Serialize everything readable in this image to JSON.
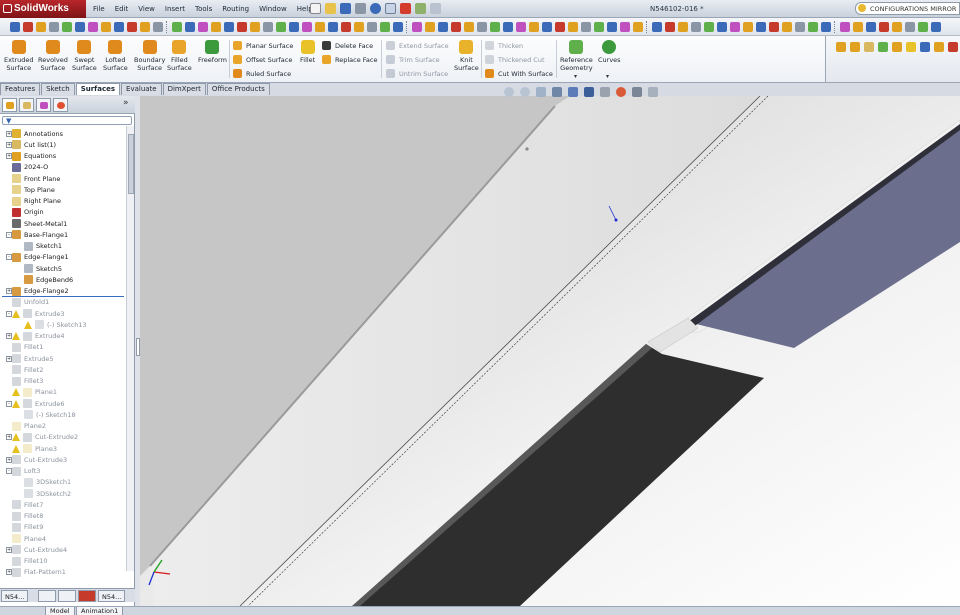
{
  "app": {
    "name": "SolidWorks",
    "document_title": "N546102-016 *",
    "config_search": "CONFIGURATIONS MIRROR"
  },
  "menu": [
    "File",
    "Edit",
    "View",
    "Insert",
    "Tools",
    "Routing",
    "Window",
    "Help"
  ],
  "command_manager": {
    "big": [
      {
        "label": "Extruded\nSurface",
        "icon": "extruded-surface-icon",
        "color": "#e08a1e"
      },
      {
        "label": "Revolved\nSurface",
        "icon": "revolved-surface-icon",
        "color": "#e08a1e"
      },
      {
        "label": "Swept\nSurface",
        "icon": "swept-surface-icon",
        "color": "#e08a1e"
      },
      {
        "label": "Lofted\nSurface",
        "icon": "lofted-surface-icon",
        "color": "#e08a1e"
      },
      {
        "label": "Boundary\nSurface",
        "icon": "boundary-surface-icon",
        "color": "#e08a1e"
      },
      {
        "label": "Filled\nSurface",
        "icon": "filled-surface-icon",
        "color": "#e8a52a"
      },
      {
        "label": "Freeform",
        "icon": "freeform-icon",
        "color": "#3c9a3c"
      }
    ],
    "small_col1": [
      {
        "label": "Planar Surface",
        "icon": "planar-surface-icon",
        "enabled": true
      },
      {
        "label": "Offset Surface",
        "icon": "offset-surface-icon",
        "enabled": true
      },
      {
        "label": "Ruled Surface",
        "icon": "ruled-surface-icon",
        "enabled": true
      }
    ],
    "fillet": {
      "label": "Fillet",
      "icon": "fillet-icon"
    },
    "small_col2": [
      {
        "label": "Delete Face",
        "icon": "delete-face-icon",
        "enabled": true
      },
      {
        "label": "Replace Face",
        "icon": "replace-face-icon",
        "enabled": true
      }
    ],
    "small_col3": [
      {
        "label": "Extend Surface",
        "icon": "extend-surface-icon",
        "enabled": false
      },
      {
        "label": "Trim Surface",
        "icon": "trim-surface-icon",
        "enabled": false
      },
      {
        "label": "Untrim Surface",
        "icon": "untrim-surface-icon",
        "enabled": false
      }
    ],
    "knit": {
      "label": "Knit\nSurface",
      "icon": "knit-surface-icon"
    },
    "small_col4": [
      {
        "label": "Thicken",
        "icon": "thicken-icon",
        "enabled": false
      },
      {
        "label": "Thickened Cut",
        "icon": "thickened-cut-icon",
        "enabled": false
      },
      {
        "label": "Cut With Surface",
        "icon": "cut-with-surface-icon",
        "enabled": true
      }
    ],
    "ref_geometry": {
      "label": "Reference\nGeometry",
      "icon": "reference-geometry-icon"
    },
    "curves": {
      "label": "Curves",
      "icon": "curves-icon"
    }
  },
  "tabs": [
    "Features",
    "Sketch",
    "Surfaces",
    "Evaluate",
    "DimXpert",
    "Office Products"
  ],
  "active_tab": "Surfaces",
  "tree": [
    {
      "label": "Annotations",
      "icon": "annotations-icon",
      "level": 0,
      "state": "normal",
      "expander": "+"
    },
    {
      "label": "Cut list(1)",
      "icon": "cut-list-icon",
      "level": 0,
      "state": "normal",
      "expander": "+"
    },
    {
      "label": "Equations",
      "icon": "equations-icon",
      "level": 0,
      "state": "normal",
      "expander": "+"
    },
    {
      "label": "2024-O",
      "icon": "material-icon",
      "level": 0,
      "state": "normal",
      "expander": ""
    },
    {
      "label": "Front Plane",
      "icon": "plane-icon",
      "level": 0,
      "state": "normal",
      "expander": ""
    },
    {
      "label": "Top Plane",
      "icon": "plane-icon",
      "level": 0,
      "state": "normal",
      "expander": ""
    },
    {
      "label": "Right Plane",
      "icon": "plane-icon",
      "level": 0,
      "state": "normal",
      "expander": ""
    },
    {
      "label": "Origin",
      "icon": "origin-icon",
      "level": 0,
      "state": "normal",
      "expander": ""
    },
    {
      "label": "Sheet-Metal1",
      "icon": "sheet-metal-icon",
      "level": 0,
      "state": "normal",
      "expander": ""
    },
    {
      "label": "Base-Flange1",
      "icon": "base-flange-icon",
      "level": 0,
      "state": "normal",
      "expander": "-"
    },
    {
      "label": "Sketch1",
      "icon": "sketch-icon",
      "level": 1,
      "state": "normal",
      "expander": ""
    },
    {
      "label": "Edge-Flange1",
      "icon": "edge-flange-icon",
      "level": 0,
      "state": "normal",
      "expander": "-"
    },
    {
      "label": "Sketch5",
      "icon": "sketch-icon",
      "level": 1,
      "state": "normal",
      "expander": ""
    },
    {
      "label": "EdgeBend6",
      "icon": "edge-bend-icon",
      "level": 1,
      "state": "normal",
      "expander": ""
    },
    {
      "label": "Edge-Flange2",
      "icon": "edge-flange-icon",
      "level": 0,
      "state": "normal",
      "expander": "+"
    },
    {
      "label": "Unfold1",
      "icon": "unfold-icon",
      "level": 0,
      "state": "suppressed",
      "expander": ""
    },
    {
      "label": "Extrude3",
      "icon": "extrude-icon",
      "level": 0,
      "state": "suppressed",
      "expander": "-",
      "warn": true
    },
    {
      "label": "(-) Sketch13",
      "icon": "sketch-icon",
      "level": 1,
      "state": "suppressed",
      "expander": "",
      "warn": true
    },
    {
      "label": "Extrude4",
      "icon": "extrude-icon",
      "level": 0,
      "state": "suppressed",
      "expander": "+",
      "warn": true
    },
    {
      "label": "Fillet1",
      "icon": "fillet-icon",
      "level": 0,
      "state": "suppressed",
      "expander": ""
    },
    {
      "label": "Extrude5",
      "icon": "extrude-icon",
      "level": 0,
      "state": "suppressed",
      "expander": "+"
    },
    {
      "label": "Fillet2",
      "icon": "fillet-icon",
      "level": 0,
      "state": "suppressed",
      "expander": ""
    },
    {
      "label": "Fillet3",
      "icon": "fillet-icon",
      "level": 0,
      "state": "suppressed",
      "expander": ""
    },
    {
      "label": "Plane1",
      "icon": "plane-icon",
      "level": 0,
      "state": "suppressed",
      "expander": "",
      "warn": true
    },
    {
      "label": "Extrude6",
      "icon": "extrude-icon",
      "level": 0,
      "state": "suppressed",
      "expander": "-",
      "warn": true
    },
    {
      "label": "(-) Sketch18",
      "icon": "sketch-icon",
      "level": 1,
      "state": "suppressed",
      "expander": ""
    },
    {
      "label": "Plane2",
      "icon": "plane-icon",
      "level": 0,
      "state": "suppressed",
      "expander": ""
    },
    {
      "label": "Cut-Extrude2",
      "icon": "cut-extrude-icon",
      "level": 0,
      "state": "suppressed",
      "expander": "+",
      "warn": true
    },
    {
      "label": "Plane3",
      "icon": "plane-icon",
      "level": 0,
      "state": "suppressed",
      "expander": "",
      "warn": true
    },
    {
      "label": "Cut-Extrude3",
      "icon": "cut-extrude-icon",
      "level": 0,
      "state": "suppressed",
      "expander": "+"
    },
    {
      "label": "Loft3",
      "icon": "loft-icon",
      "level": 0,
      "state": "suppressed",
      "expander": "-"
    },
    {
      "label": "3DSketch1",
      "icon": "sketch-icon",
      "level": 1,
      "state": "suppressed",
      "expander": ""
    },
    {
      "label": "3DSketch2",
      "icon": "sketch-icon",
      "level": 1,
      "state": "suppressed",
      "expander": ""
    },
    {
      "label": "Fillet7",
      "icon": "fillet-icon",
      "level": 0,
      "state": "suppressed",
      "expander": ""
    },
    {
      "label": "Fillet8",
      "icon": "fillet-icon",
      "level": 0,
      "state": "suppressed",
      "expander": ""
    },
    {
      "label": "Fillet9",
      "icon": "fillet-icon",
      "level": 0,
      "state": "suppressed",
      "expander": ""
    },
    {
      "label": "Plane4",
      "icon": "plane-icon",
      "level": 0,
      "state": "suppressed",
      "expander": ""
    },
    {
      "label": "Cut-Extrude4",
      "icon": "cut-extrude-icon",
      "level": 0,
      "state": "suppressed",
      "expander": "+"
    },
    {
      "label": "Fillet10",
      "icon": "fillet-icon",
      "level": 0,
      "state": "suppressed",
      "expander": ""
    },
    {
      "label": "Flat-Pattern1",
      "icon": "flat-pattern-icon",
      "level": 0,
      "state": "suppressed",
      "expander": "+"
    }
  ],
  "bottom": {
    "doc_tab_1": "N54...",
    "doc_tab_2": "N54...",
    "model_tab": "Model",
    "animation_tab": "Animation1"
  },
  "colors": {
    "accent_red": "#b8272b",
    "viewport_bg": "#ffffff",
    "flange_dark": "#2e2e2e",
    "flange_blue": "#6b6e8c",
    "warning": "#e6c01f"
  }
}
